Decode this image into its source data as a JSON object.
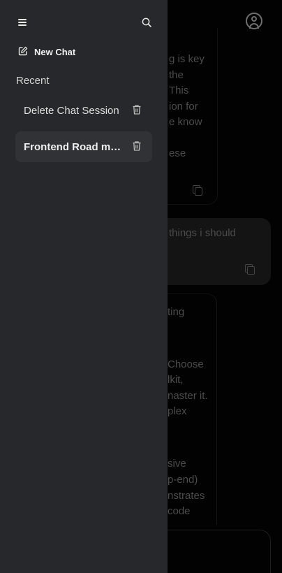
{
  "drawer": {
    "new_chat_label": "New Chat",
    "recent_label": "Recent",
    "chats": [
      {
        "label": "Delete Chat Session"
      },
      {
        "label": "Frontend Road map",
        "active": true
      }
    ]
  },
  "background_chat": {
    "bot_message_1_lines": [
      "g is key",
      "the",
      "This",
      "ion for",
      "e know",
      "",
      "ese"
    ],
    "user_message_lines": [
      "things i should"
    ],
    "bot_message_2_lines": [
      "ting",
      "",
      "",
      "Choose",
      "lkit,",
      "naster it.",
      "plex",
      "",
      "",
      "sive",
      "p-end)",
      "nstrates",
      "code"
    ]
  },
  "colors": {
    "drawer_bg": "#27282b",
    "active_item_bg": "#313236",
    "page_bg": "#020202"
  },
  "icons": [
    "menu-icon",
    "search-icon",
    "edit-icon",
    "trash-icon",
    "account-icon",
    "copy-icon"
  ]
}
